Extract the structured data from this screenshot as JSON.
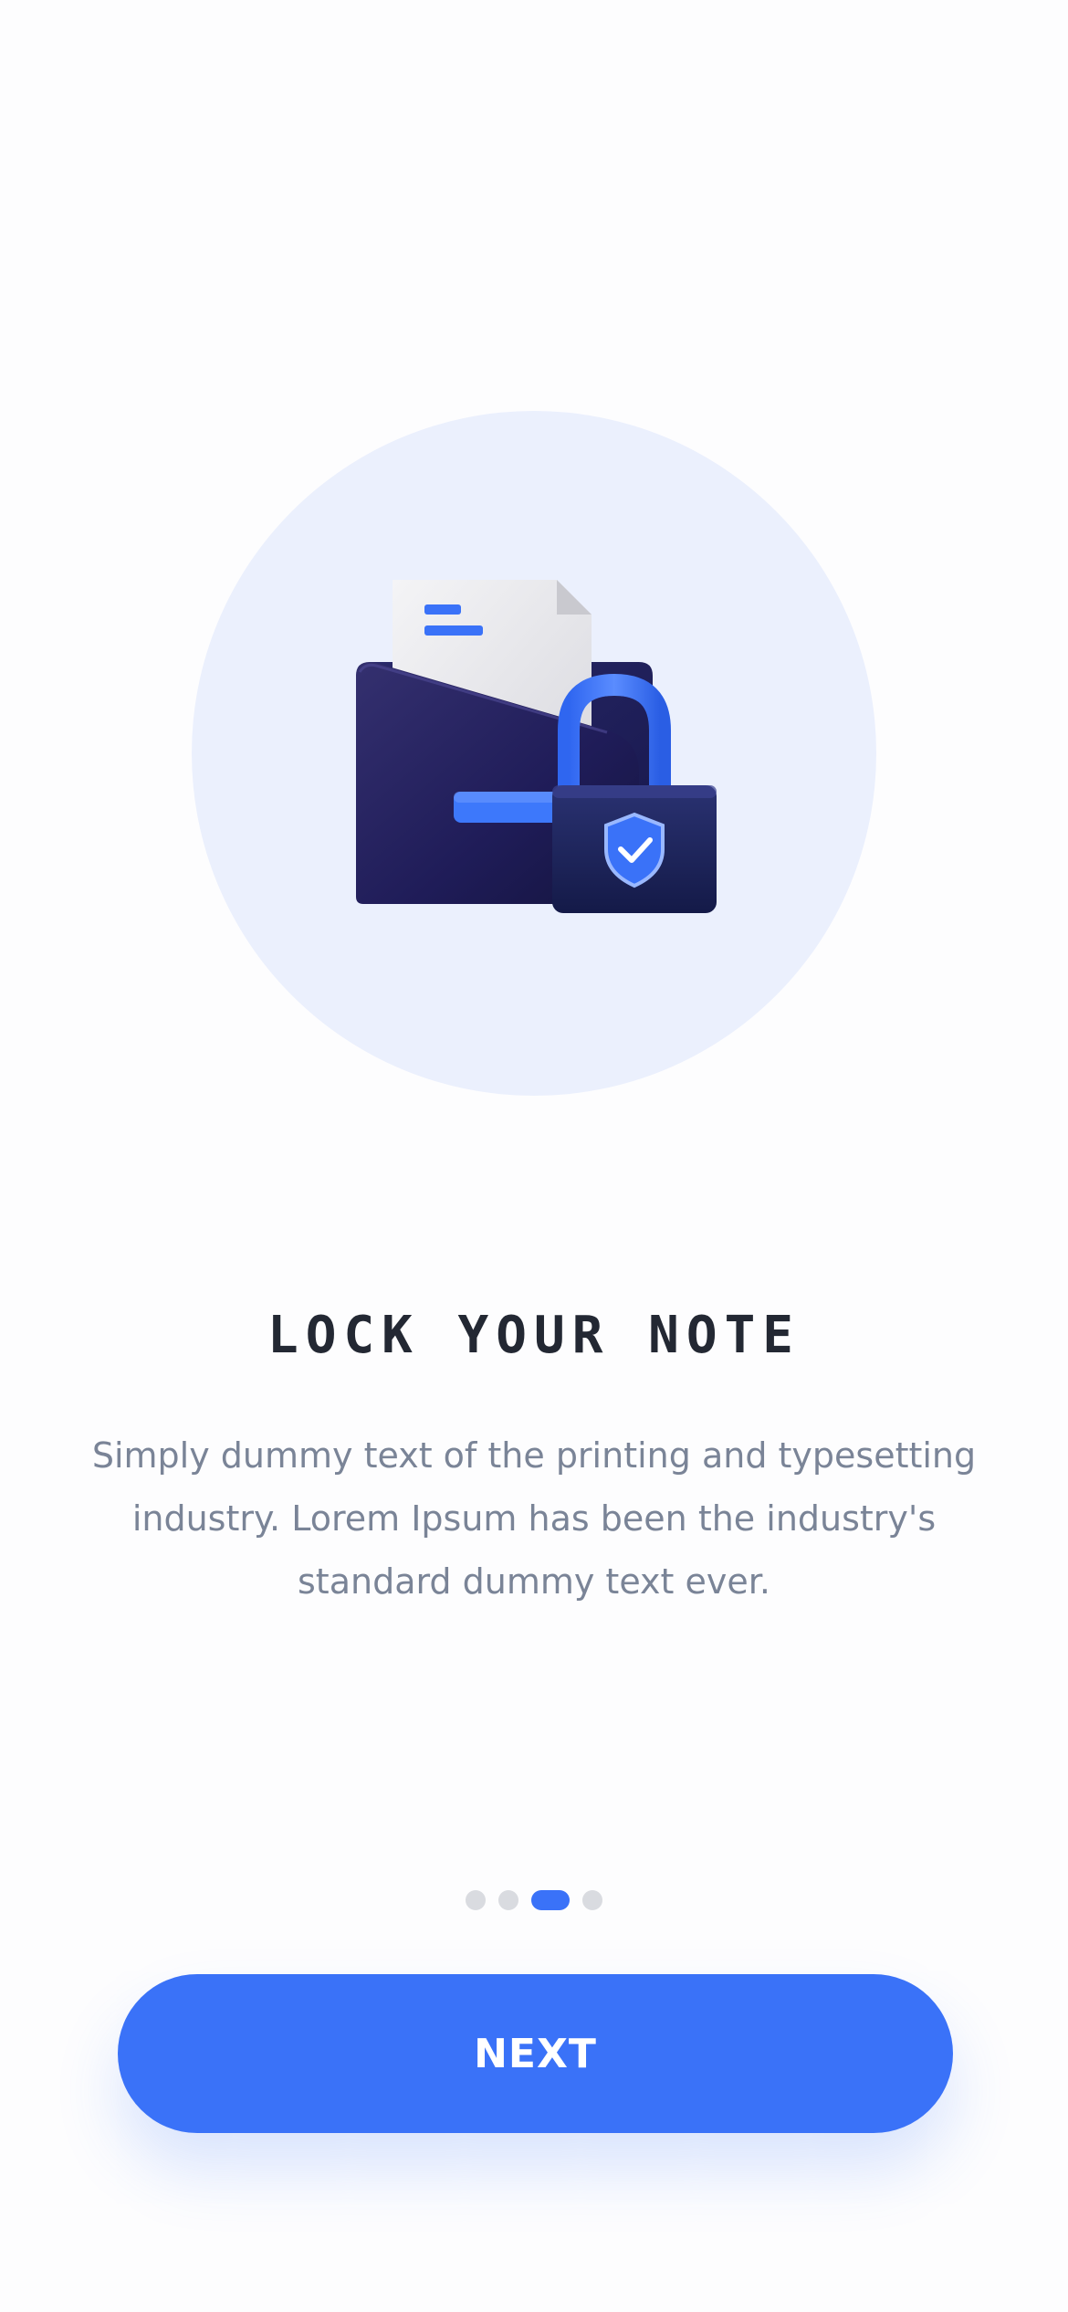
{
  "onboarding": {
    "title": "LOCK YOUR NOTE",
    "description": "Simply dummy text of the printing and typesetting industry. Lorem Ipsum has been the industry's standard dummy text ever.",
    "illustration_icon": "folder-lock-icon",
    "pager": {
      "total_pages": 4,
      "active_page": 3
    },
    "next_label": "NEXT"
  },
  "colors": {
    "accent": "#3a72f8",
    "hero_background": "#ebf0fd",
    "title": "#232833",
    "description": "#7a8497",
    "dot_inactive": "#d9dbe0"
  }
}
